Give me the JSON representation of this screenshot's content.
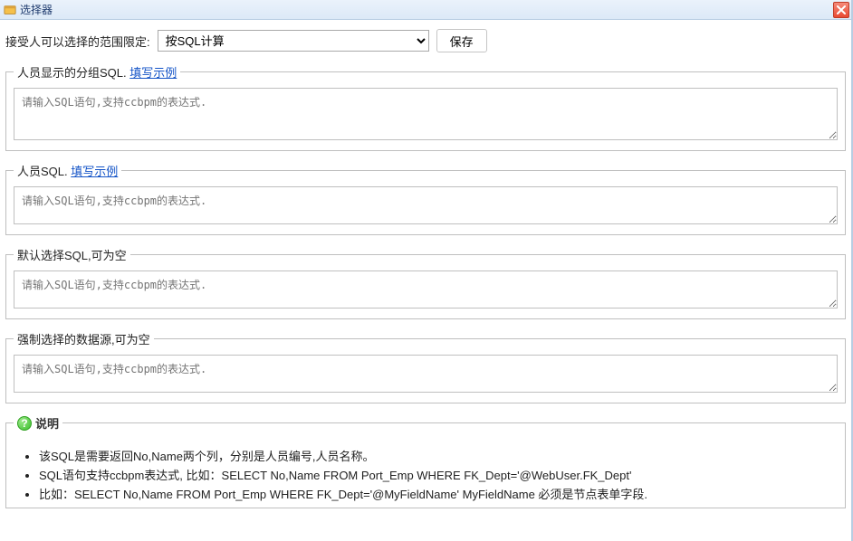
{
  "window": {
    "title": "选择器"
  },
  "topbar": {
    "label": "接受人可以选择的范围限定:",
    "selected_option": "按SQL计算",
    "save_label": "保存"
  },
  "fieldsets": {
    "group_sql": {
      "legend_text": "人员显示的分组SQL.",
      "example_link": "填写示例",
      "placeholder": "请输入SQL语句,支持ccbpm的表达式."
    },
    "person_sql": {
      "legend_text": "人员SQL.",
      "example_link": "填写示例",
      "placeholder": "请输入SQL语句,支持ccbpm的表达式."
    },
    "default_sql": {
      "legend_text": "默认选择SQL,可为空",
      "placeholder": "请输入SQL语句,支持ccbpm的表达式."
    },
    "force_sql": {
      "legend_text": "强制选择的数据源,可为空",
      "placeholder": "请输入SQL语句,支持ccbpm的表达式."
    }
  },
  "help": {
    "title": "说明",
    "items": [
      "该SQL是需要返回No,Name两个列，分别是人员编号,人员名称。",
      "SQL语句支持ccbpm表达式, 比如：SELECT No,Name FROM Port_Emp WHERE FK_Dept='@WebUser.FK_Dept'",
      "比如：SELECT No,Name FROM Port_Emp WHERE FK_Dept='@MyFieldName' MyFieldName 必须是节点表单字段."
    ]
  }
}
